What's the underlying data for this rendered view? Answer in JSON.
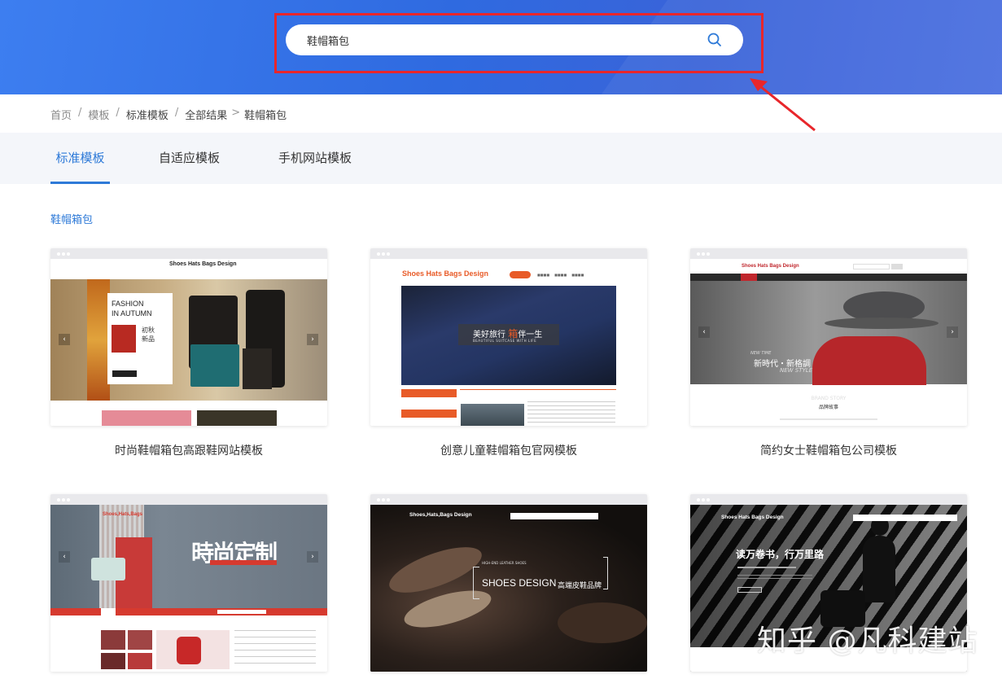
{
  "search": {
    "value": "鞋帽箱包"
  },
  "breadcrumb": {
    "items": [
      "首页",
      "模板",
      "标准模板",
      "全部结果",
      "鞋帽箱包"
    ],
    "separators": [
      "/",
      "/",
      "/",
      ">"
    ]
  },
  "tabs": [
    {
      "label": "标准模板",
      "active": true
    },
    {
      "label": "自适应模板",
      "active": false
    },
    {
      "label": "手机网站模板",
      "active": false
    }
  ],
  "section_title": "鞋帽箱包",
  "templates": [
    {
      "title": "时尚鞋帽箱包高跟鞋网站模板",
      "site_logo": "Shoes Hats Bags Design",
      "banner_text": [
        "FASHION",
        "IN AUTUMN",
        "初秋",
        "新品"
      ]
    },
    {
      "title": "创意儿童鞋帽箱包官网模板",
      "site_logo": "Shoes Hats Bags Design",
      "banner_text": [
        "美好旅行",
        "箱",
        "伴一生",
        "BEAUTIFUL SUITCASE WITH LIFE"
      ]
    },
    {
      "title": "简约女士鞋帽箱包公司模板",
      "site_logo": "Shoes Hats Bags Design",
      "banner_text": [
        "NEW TIME",
        "新時代・新格調",
        "NEW STYLE",
        "BRAND STORY",
        "品牌故事"
      ]
    },
    {
      "title": "",
      "site_logo": "Shoes,Hats,Bags",
      "banner_text": [
        "時尚定制"
      ]
    },
    {
      "title": "",
      "site_logo": "Shoes,Hats,Bags Design",
      "banner_text": [
        "HIGH-END LEATHER SHOES",
        "SHOES DESIGN",
        "高端皮鞋品牌"
      ]
    },
    {
      "title": "",
      "site_logo": "Shoes Hats Bags Design",
      "banner_text": [
        "读万卷书，行万里路"
      ]
    }
  ],
  "watermark": "知乎 @凡科建站",
  "colors": {
    "accent": "#2e7ad8",
    "highlight": "#e8262b",
    "banner": "#3170e4"
  }
}
